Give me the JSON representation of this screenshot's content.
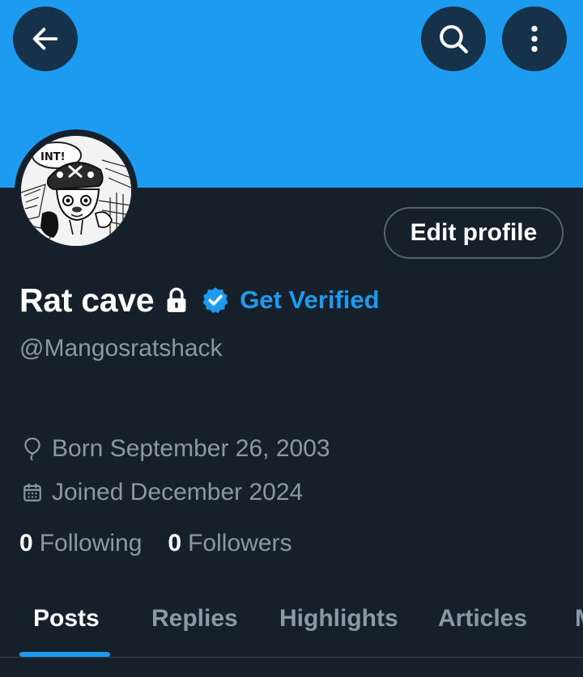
{
  "header": {
    "back_icon": "arrow-left-icon",
    "search_icon": "search-icon",
    "more_icon": "more-vertical-icon"
  },
  "profile": {
    "display_name": "Rat cave",
    "protected_icon": "lock-icon",
    "verified_icon": "verified-badge-icon",
    "get_verified_label": "Get Verified",
    "handle": "@Mangosratshack",
    "born": "Born September 26, 2003",
    "joined": "Joined December 2024",
    "following_count": "0",
    "following_label": "Following",
    "followers_count": "0",
    "followers_label": "Followers"
  },
  "actions": {
    "edit_profile_label": "Edit profile"
  },
  "tabs": [
    {
      "label": "Posts",
      "active": true
    },
    {
      "label": "Replies",
      "active": false
    },
    {
      "label": "Highlights",
      "active": false
    },
    {
      "label": "Articles",
      "active": false
    },
    {
      "label": "Media",
      "active": false
    }
  ],
  "colors": {
    "banner": "#1d9bf0",
    "background": "#15202b",
    "accent": "#1d9bf0",
    "secondary_text": "#8b98a5",
    "icon_button": "#16324a"
  }
}
